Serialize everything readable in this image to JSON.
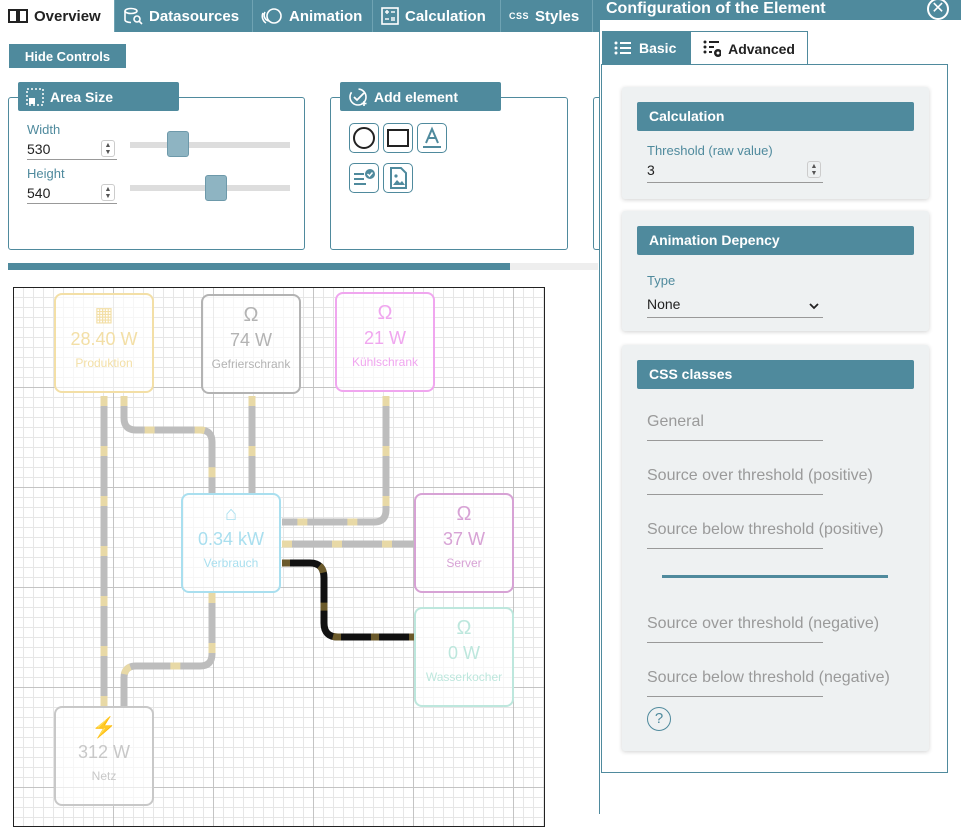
{
  "tabs": [
    {
      "label": "Overview",
      "icon": "columns-icon",
      "active": true
    },
    {
      "label": "Datasources",
      "icon": "database-search-icon"
    },
    {
      "label": "Animation",
      "icon": "animation-icon"
    },
    {
      "label": "Calculation",
      "icon": "calculator-icon"
    },
    {
      "label": "Styles",
      "icon": "css-icon",
      "badge": "CSS"
    }
  ],
  "controls": {
    "hide_label": "Hide Controls",
    "area_size": {
      "title": "Area Size",
      "width_label": "Width",
      "width_value": "530",
      "height_label": "Height",
      "height_value": "540"
    },
    "add_element": {
      "title": "Add element"
    },
    "progress_fraction": 0.85
  },
  "canvas": {
    "nodes": [
      {
        "id": "produktion",
        "value": "28.40 W",
        "label": "Produktion",
        "color": "#f3dfa6",
        "icon": "solar-panel-icon",
        "icon_char": "▦"
      },
      {
        "id": "gefrierschrank",
        "value": "74 W",
        "label": "Gefrierschrank",
        "color": "#b3b3b3",
        "icon": "omega-icon",
        "icon_char": "Ω"
      },
      {
        "id": "kuehlschrank",
        "value": "21 W",
        "label": "Kühlschrank",
        "color": "#f0a6ef",
        "icon": "omega-icon",
        "icon_char": "Ω"
      },
      {
        "id": "verbrauch",
        "value": "0.34 kW",
        "label": "Verbrauch",
        "color": "#a9dfef",
        "icon": "house-icon",
        "icon_char": "⌂"
      },
      {
        "id": "server",
        "value": "37 W",
        "label": "Server",
        "color": "#d7a2d5",
        "icon": "omega-icon",
        "icon_char": "Ω"
      },
      {
        "id": "wasserkocher",
        "value": "0 W",
        "label": "Wasserkocher",
        "color": "#bde7dd",
        "icon": "omega-icon",
        "icon_char": "Ω"
      },
      {
        "id": "netz",
        "value": "312 W",
        "label": "Netz",
        "color": "#c8c8c8",
        "icon": "power-pylon-icon",
        "icon_char": "⚡"
      }
    ]
  },
  "config": {
    "title": "Configuration of the Element",
    "tab_basic": "Basic",
    "tab_advanced": "Advanced",
    "calculation": {
      "title": "Calculation",
      "threshold_label": "Threshold (raw value)",
      "threshold_value": "3"
    },
    "animation": {
      "title": "Animation Depency",
      "type_label": "Type",
      "type_value": "None"
    },
    "css": {
      "title": "CSS classes",
      "general": "General",
      "over_pos": "Source over threshold (positive)",
      "below_pos": "Source below threshold (positive)",
      "over_neg": "Source over threshold (negative)",
      "below_neg": "Source below threshold (negative)",
      "help": "?"
    }
  }
}
